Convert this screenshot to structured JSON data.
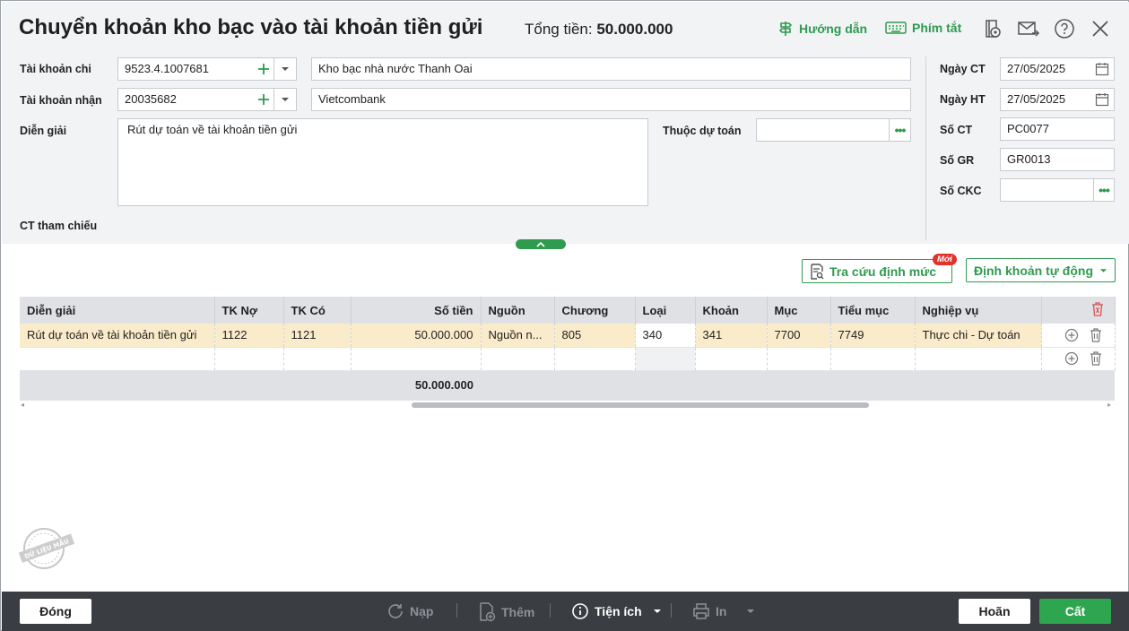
{
  "header": {
    "title": "Chuyển khoản kho bạc vào tài khoản tiền gửi",
    "total_label": "Tổng tiền:",
    "total_value": "50.000.000",
    "guide_label": "Hướng dẫn",
    "shortcut_label": "Phím tắt"
  },
  "form": {
    "tk_chi": {
      "label": "Tài khoản chi",
      "value": "9523.4.1007681",
      "name": "Kho bạc nhà nước Thanh Oai"
    },
    "tk_nhan": {
      "label": "Tài khoản nhận",
      "value": "20035682",
      "name": "Vietcombank"
    },
    "dien_giai": {
      "label": "Diễn giải",
      "value": "Rút dự toán về tài khoản tiền gửi"
    },
    "thuoc_du_toan": {
      "label": "Thuộc dự toán",
      "value": ""
    },
    "ct_tham_chieu": {
      "label": "CT tham chiếu"
    },
    "ngay_ct": {
      "label": "Ngày CT",
      "value": "27/05/2025"
    },
    "ngay_ht": {
      "label": "Ngày HT",
      "value": "27/05/2025"
    },
    "so_ct": {
      "label": "Số CT",
      "value": "PC0077"
    },
    "so_gr": {
      "label": "Số GR",
      "value": "GR0013"
    },
    "so_ckc": {
      "label": "Số CKC",
      "value": ""
    }
  },
  "actions": {
    "tra_cuu_label": "Tra cứu định mức",
    "new_badge": "Mới",
    "dinh_khoan_label": "Định khoản tự động"
  },
  "grid": {
    "columns": [
      "Diễn giải",
      "TK Nợ",
      "TK Có",
      "Số tiền",
      "Nguồn",
      "Chương",
      "Loại",
      "Khoản",
      "Mục",
      "Tiểu mục",
      "Nghiệp vụ"
    ],
    "rows": [
      [
        "Rút dự toán về tài khoản tiền gửi",
        "1122",
        "1121",
        "50.000.000",
        "Nguồn n...",
        "805",
        "340",
        "341",
        "7700",
        "7749",
        "Thực chi - Dự toán"
      ]
    ],
    "footer_total": "50.000.000"
  },
  "stamp_text": "DỮ LIỆU MẪU",
  "bottom": {
    "close_label": "Đóng",
    "reload_label": "Nạp",
    "add_label": "Thêm",
    "utility_label": "Tiện ích",
    "print_label": "In",
    "cancel_label": "Hoãn",
    "save_label": "Cất"
  },
  "colors": {
    "accent": "#2e9b4f",
    "selected_row": "#faeccb",
    "bottom_bar": "#3a3d42",
    "badge": "#e2322c"
  }
}
